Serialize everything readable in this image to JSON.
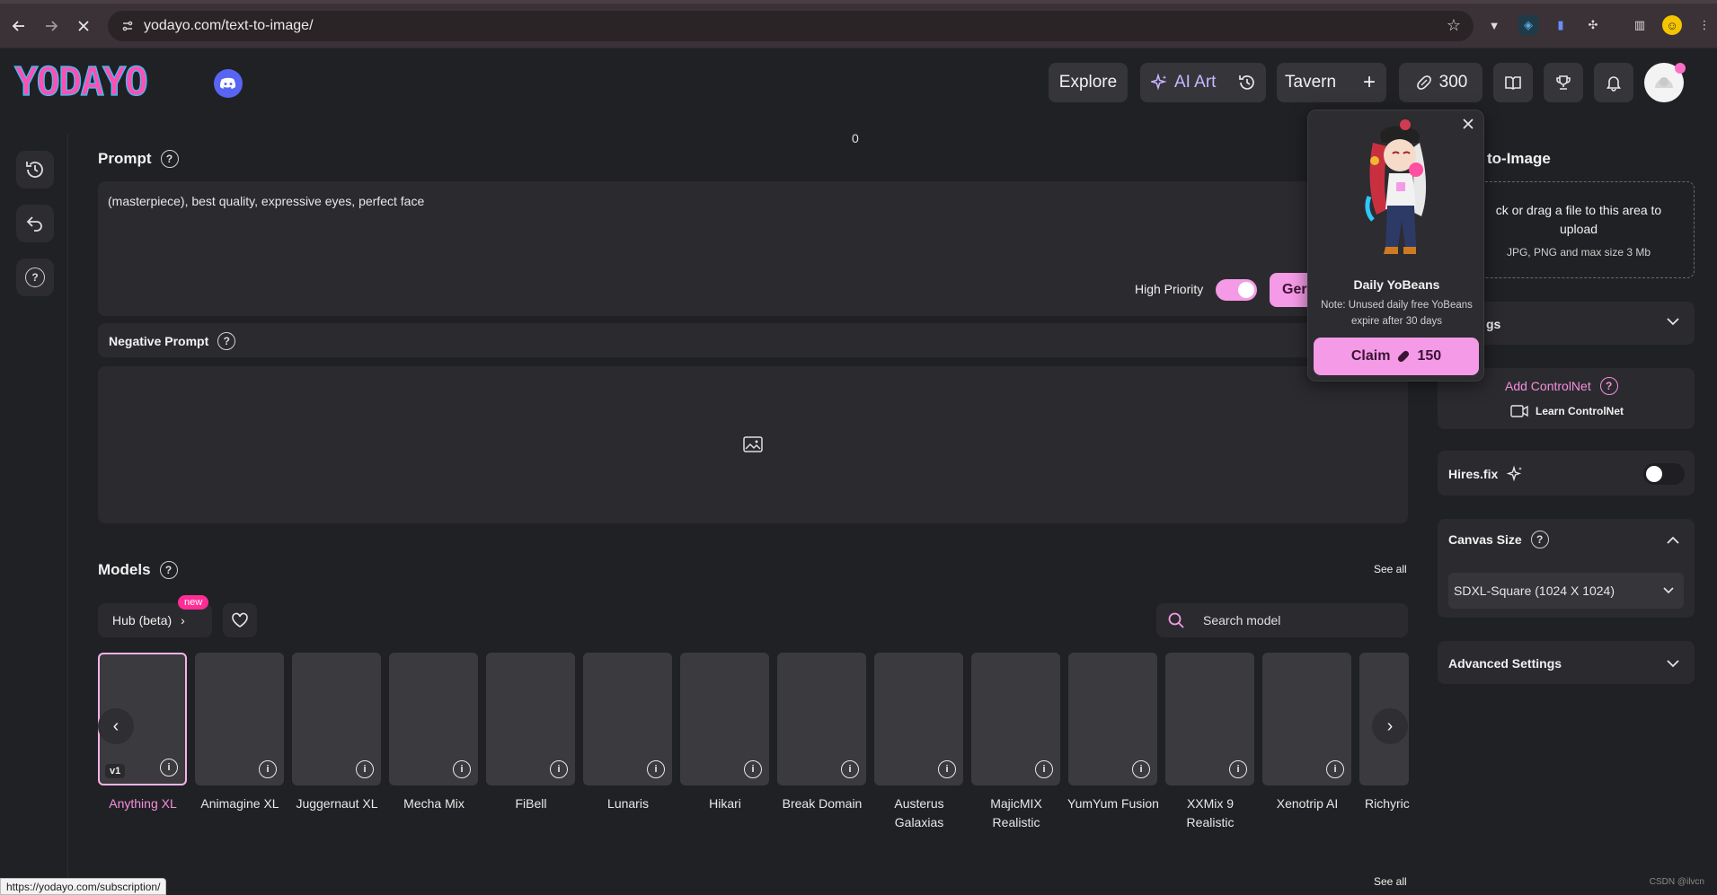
{
  "browser": {
    "url": "yodayo.com/text-to-image/",
    "status_url": "https://yodayo.com/subscription/"
  },
  "header": {
    "logo_text": "YODAYO",
    "explore": "Explore",
    "ai_art": "AI Art",
    "tavern": "Tavern",
    "beans": "300"
  },
  "main": {
    "counter": "0",
    "prompt_title": "Prompt",
    "prompt_value": "(masterpiece), best quality, expressive eyes, perfect face",
    "high_priority_label": "High Priority",
    "high_priority_on": true,
    "generate_label": "Ger",
    "negative_title": "Negative Prompt",
    "models_title": "Models",
    "see_all": "See all",
    "hub_label": "Hub (beta)",
    "new_badge": "new",
    "search_placeholder": "Search model",
    "version_badge": "v1",
    "models": [
      {
        "name": "Anything XL",
        "selected": true
      },
      {
        "name": "Animagine XL"
      },
      {
        "name": "Juggernaut XL"
      },
      {
        "name": "Mecha Mix"
      },
      {
        "name": "FiBell"
      },
      {
        "name": "Lunaris"
      },
      {
        "name": "Hikari"
      },
      {
        "name": "Break Domain"
      },
      {
        "name": "Austerus Galaxias"
      },
      {
        "name": "MajicMIX Realistic"
      },
      {
        "name": "YumYum Fusion"
      },
      {
        "name": "XXMix 9 Realistic"
      },
      {
        "name": "Xenotrip AI"
      },
      {
        "name": "Richyric"
      }
    ],
    "bottom_see_all": "See all"
  },
  "sidebar": {
    "i2i_title": "to-Image",
    "upload_text": "ck or drag a file to this area to upload",
    "upload_hint": "JPG, PNG and max size 3 Mb",
    "settings_label": "gs",
    "add_controlnet": "Add ControlNet",
    "learn_controlnet": "Learn ControlNet",
    "hires_label": "Hires.fix",
    "hires_on": false,
    "canvas_title": "Canvas Size",
    "canvas_value": "SDXL-Square (1024 X 1024)",
    "advanced": "Advanced Settings"
  },
  "popover": {
    "title": "Daily YoBeans",
    "note": "Note: Unused daily free YoBeans expire after 30 days",
    "claim_label": "Claim",
    "claim_amount": "150"
  },
  "watermark": "CSDN @ilvcn",
  "colors": {
    "accent_pink": "#f49ae6",
    "toggle_on": "#f49ae6",
    "link_pink": "#f58fdc"
  }
}
